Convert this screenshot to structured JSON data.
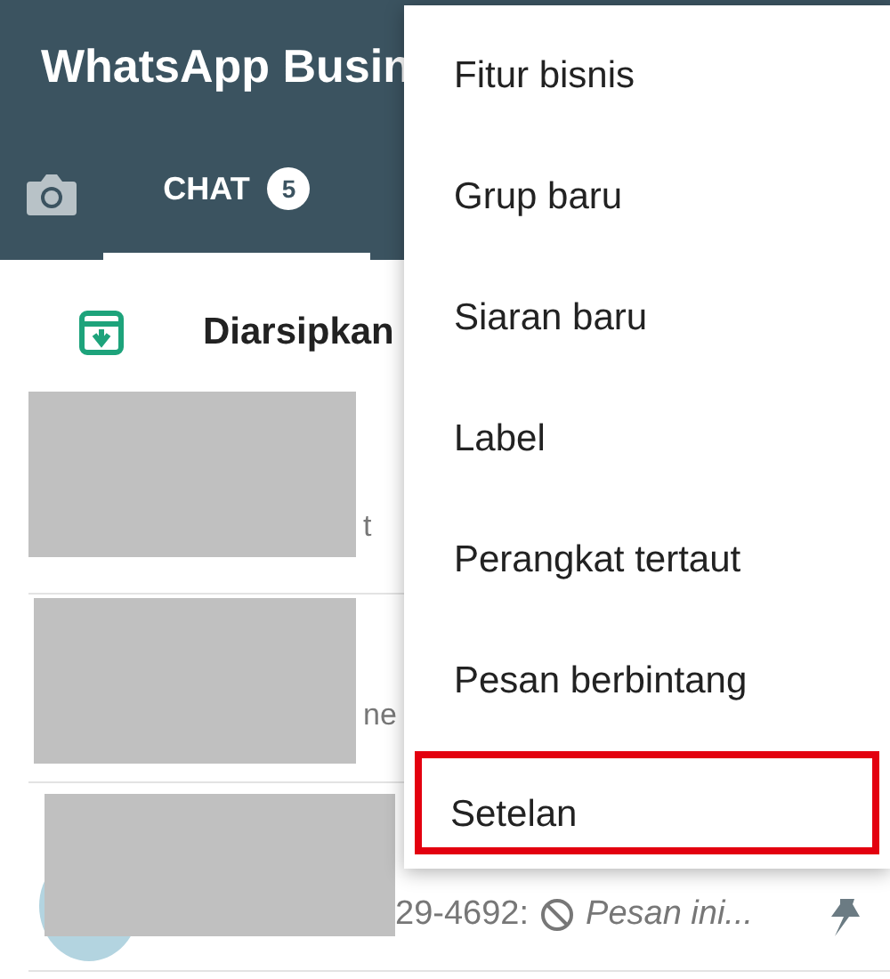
{
  "app_bar": {
    "title": "WhatsApp Busin"
  },
  "tabs": [
    {
      "label": "CHAT",
      "badge": "5",
      "selected": true
    }
  ],
  "archived": {
    "label": "Diarsipkan"
  },
  "chats": [
    {
      "fragment": "t"
    },
    {
      "fragment": "ne"
    },
    {
      "preview_number": "29-4692:",
      "preview_text": "Pesan ini...",
      "pinned": true
    }
  ],
  "menu": {
    "items": [
      {
        "label": "Fitur bisnis",
        "highlighted": false
      },
      {
        "label": "Grup baru",
        "highlighted": false
      },
      {
        "label": "Siaran baru",
        "highlighted": false
      },
      {
        "label": "Label",
        "highlighted": false
      },
      {
        "label": "Perangkat tertaut",
        "highlighted": false
      },
      {
        "label": "Pesan berbintang",
        "highlighted": false
      },
      {
        "label": "Setelan",
        "highlighted": true
      }
    ]
  }
}
